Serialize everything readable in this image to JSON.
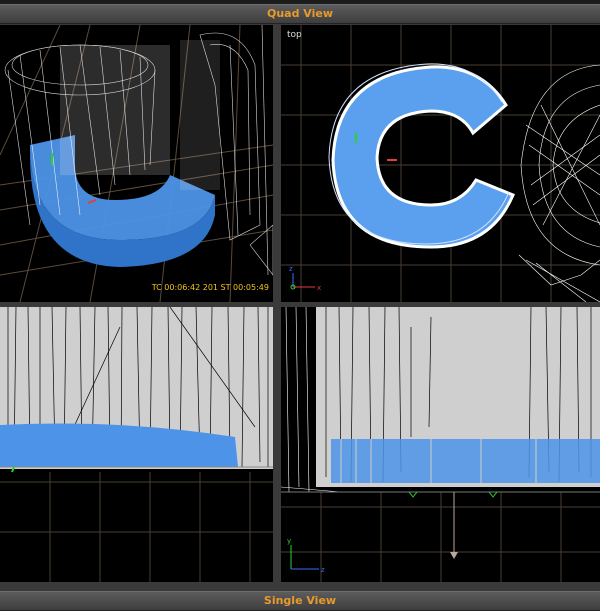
{
  "header": {
    "title": "Quad View"
  },
  "footer": {
    "title": "Single View"
  },
  "viewports": {
    "top": {
      "label": "top"
    },
    "perspective": {
      "timecode": "TC 00:06:42 201   ST 00:05:49"
    }
  },
  "colors": {
    "panel_title": "#e89a2c",
    "timecode": "#f2c418",
    "solid_object": "#4d94e8",
    "wireframe": "#ffffff",
    "grid": "#5a4a3a"
  }
}
